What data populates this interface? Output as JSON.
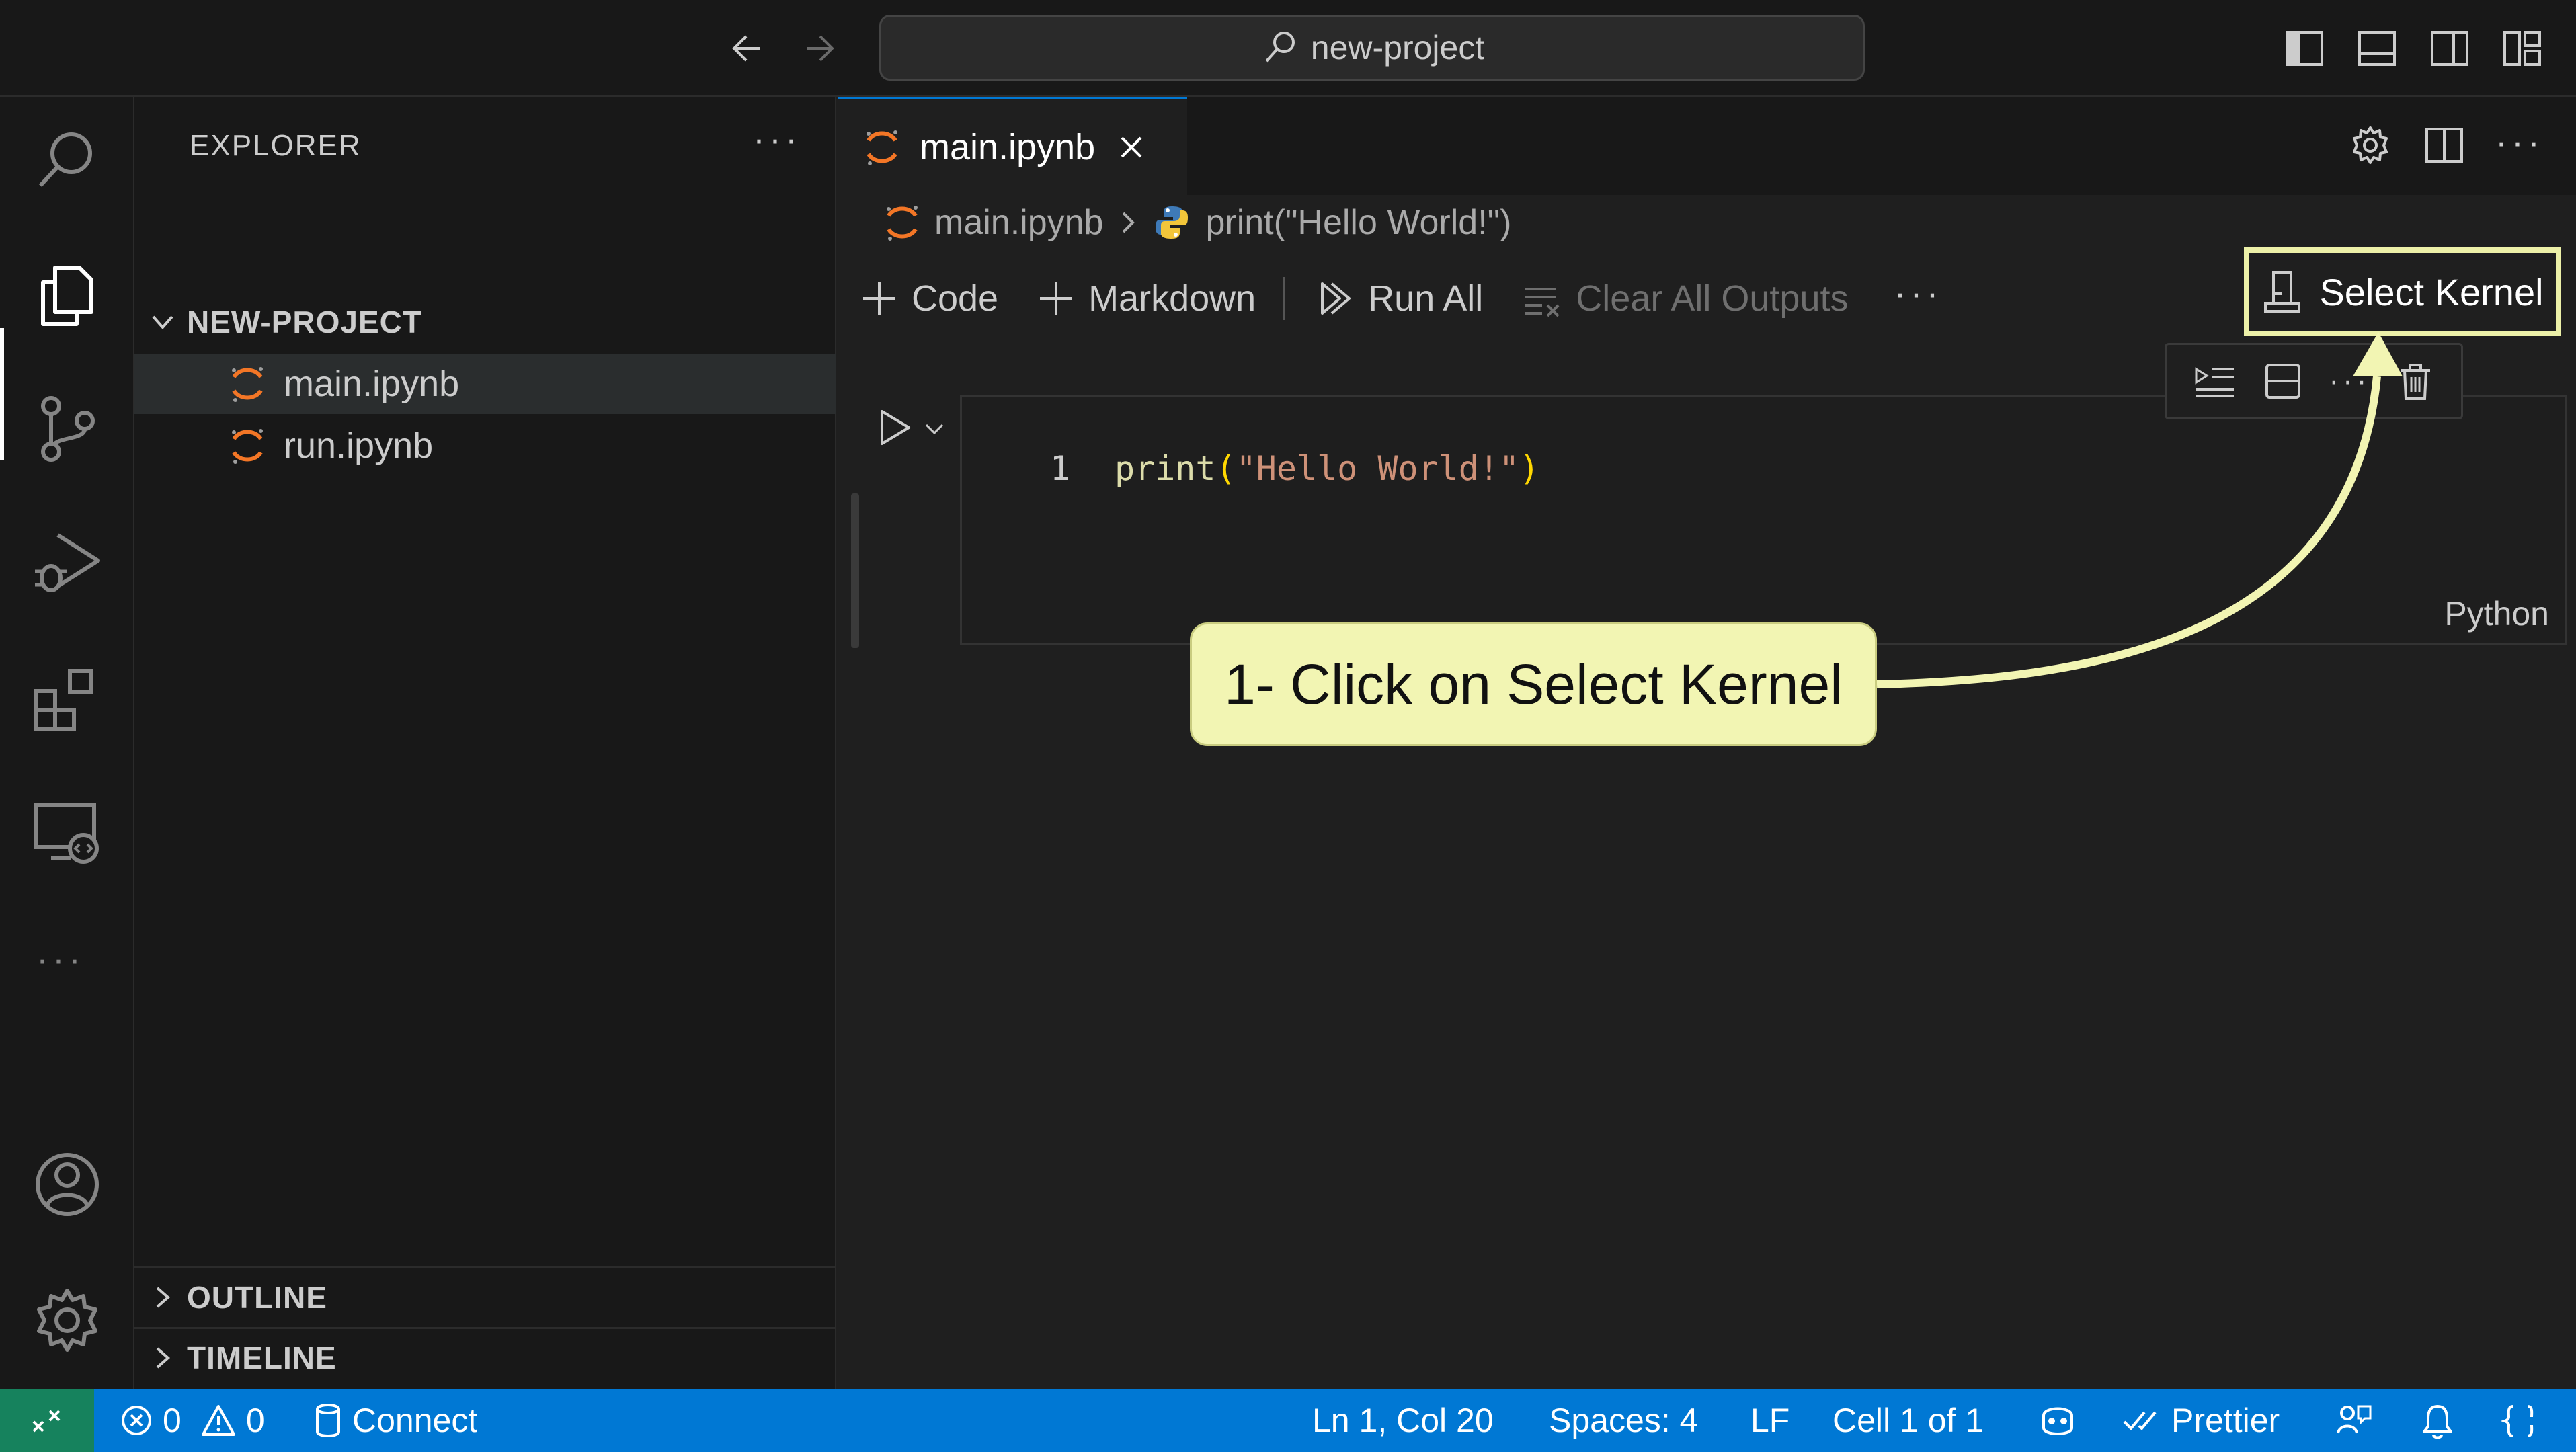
{
  "titlebar": {
    "search_text": "new-project"
  },
  "sidebar": {
    "title": "EXPLORER",
    "project": "NEW-PROJECT",
    "files": [
      {
        "name": "main.ipynb"
      },
      {
        "name": "run.ipynb"
      }
    ],
    "outline": "OUTLINE",
    "timeline": "TIMELINE"
  },
  "editor": {
    "tab": {
      "label": "main.ipynb"
    },
    "breadcrumb": {
      "file": "main.ipynb",
      "symbol": "print(\"Hello World!\")"
    },
    "toolbar": {
      "code": "Code",
      "markdown": "Markdown",
      "run_all": "Run All",
      "clear_outputs": "Clear All Outputs",
      "select_kernel": "Select Kernel"
    },
    "cell": {
      "line_number": "1",
      "code_fn": "print",
      "code_open": "(",
      "code_str": "\"Hello World!\"",
      "code_close": ")",
      "language": "Python"
    }
  },
  "callout": {
    "text": "1- Click on Select Kernel",
    "color": "#f2f5b3"
  },
  "statusbar": {
    "errors": "0",
    "warnings": "0",
    "connect": "Connect",
    "position": "Ln 1, Col 20",
    "spaces": "Spaces: 4",
    "eol": "LF",
    "cell": "Cell 1 of 1",
    "prettier": "Prettier"
  },
  "colors": {
    "accent": "#0078d4",
    "remote": "#16825d",
    "highlight_border": "#ecf0a8"
  }
}
